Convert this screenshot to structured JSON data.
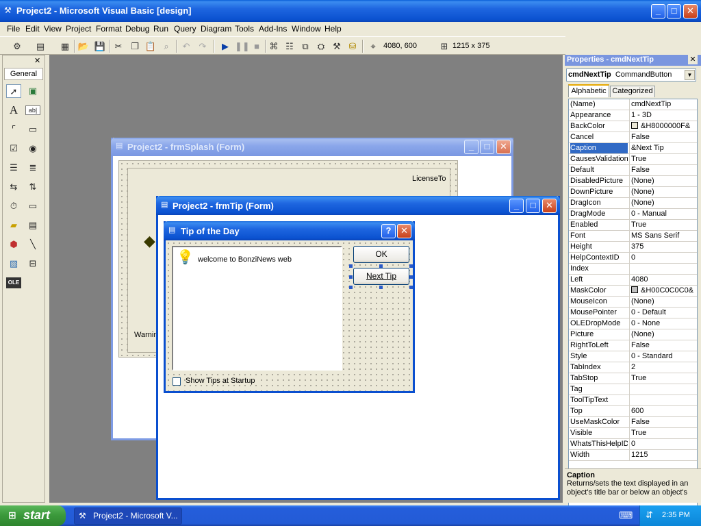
{
  "app": {
    "title": "Project2 - Microsoft Visual Basic [design]",
    "min_glyph": "_",
    "max_glyph": "□",
    "close_glyph": "✕"
  },
  "menu": [
    "File",
    "Edit",
    "View",
    "Project",
    "Format",
    "Debug",
    "Run",
    "Query",
    "Diagram",
    "Tools",
    "Add-Ins",
    "Window",
    "Help"
  ],
  "toolbar": {
    "position": "4080, 600",
    "size": "1215 x 375"
  },
  "toolbox": {
    "close_glyph": "✕",
    "tab": "General",
    "tools": [
      "pointer-icon",
      "picturebox-icon",
      "label-icon",
      "textbox-icon",
      "frame-icon",
      "commandbutton-icon",
      "checkbox-icon",
      "optionbutton-icon",
      "combobox-icon",
      "listbox-icon",
      "hscrollbar-icon",
      "vscrollbar-icon",
      "timer-icon",
      "drivelistbox-icon",
      "dirlistbox-icon",
      "filelistbox-icon",
      "shape-icon",
      "line-icon",
      "image-icon",
      "data-icon",
      "ole-icon"
    ]
  },
  "splash": {
    "title": "Project2 - frmSplash (Form)",
    "license_label": "LicenseTo",
    "warning_label": "Warnin"
  },
  "frmtip": {
    "title": "Project2 - frmTip (Form)"
  },
  "tipday": {
    "title": "Tip of the Day",
    "help_glyph": "?",
    "tip_text": "welcome to  BonziNews web",
    "ok_label": "OK",
    "next_label": "Next Tip",
    "show_tips_label": "Show Tips at Startup"
  },
  "properties": {
    "title": "Properties - cmdNextTip",
    "object_name": "cmdNextTip",
    "object_type": "CommandButton",
    "tab_alpha": "Alphabetic",
    "tab_cat": "Categorized",
    "rows": [
      {
        "name": "(Name)",
        "value": "cmdNextTip"
      },
      {
        "name": "Appearance",
        "value": "1 - 3D"
      },
      {
        "name": "BackColor",
        "value": "&H8000000F&"
      },
      {
        "name": "Cancel",
        "value": "False"
      },
      {
        "name": "Caption",
        "value": "&Next Tip"
      },
      {
        "name": "CausesValidation",
        "value": "True"
      },
      {
        "name": "Default",
        "value": "False"
      },
      {
        "name": "DisabledPicture",
        "value": "(None)"
      },
      {
        "name": "DownPicture",
        "value": "(None)"
      },
      {
        "name": "DragIcon",
        "value": "(None)"
      },
      {
        "name": "DragMode",
        "value": "0 - Manual"
      },
      {
        "name": "Enabled",
        "value": "True"
      },
      {
        "name": "Font",
        "value": "MS Sans Serif"
      },
      {
        "name": "Height",
        "value": "375"
      },
      {
        "name": "HelpContextID",
        "value": "0"
      },
      {
        "name": "Index",
        "value": ""
      },
      {
        "name": "Left",
        "value": "4080"
      },
      {
        "name": "MaskColor",
        "value": "&H00C0C0C0&"
      },
      {
        "name": "MouseIcon",
        "value": "(None)"
      },
      {
        "name": "MousePointer",
        "value": "0 - Default"
      },
      {
        "name": "OLEDropMode",
        "value": "0 - None"
      },
      {
        "name": "Picture",
        "value": "(None)"
      },
      {
        "name": "RightToLeft",
        "value": "False"
      },
      {
        "name": "Style",
        "value": "0 - Standard"
      },
      {
        "name": "TabIndex",
        "value": "2"
      },
      {
        "name": "TabStop",
        "value": "True"
      },
      {
        "name": "Tag",
        "value": ""
      },
      {
        "name": "ToolTipText",
        "value": ""
      },
      {
        "name": "Top",
        "value": "600"
      },
      {
        "name": "UseMaskColor",
        "value": "False"
      },
      {
        "name": "Visible",
        "value": "True"
      },
      {
        "name": "WhatsThisHelpID",
        "value": "0"
      },
      {
        "name": "Width",
        "value": "1215"
      }
    ],
    "selected_index": 4,
    "desc_title": "Caption",
    "desc_text": "Returns/sets the text displayed in an object's title bar or below an object's"
  },
  "taskbar": {
    "start_label": "start",
    "task_label": "Project2 - Microsoft V...",
    "clock": "2:35 PM"
  },
  "colors": {
    "selection": "#316ac5",
    "title_active": "#0a5fd8",
    "mdi_background": "#808080"
  }
}
